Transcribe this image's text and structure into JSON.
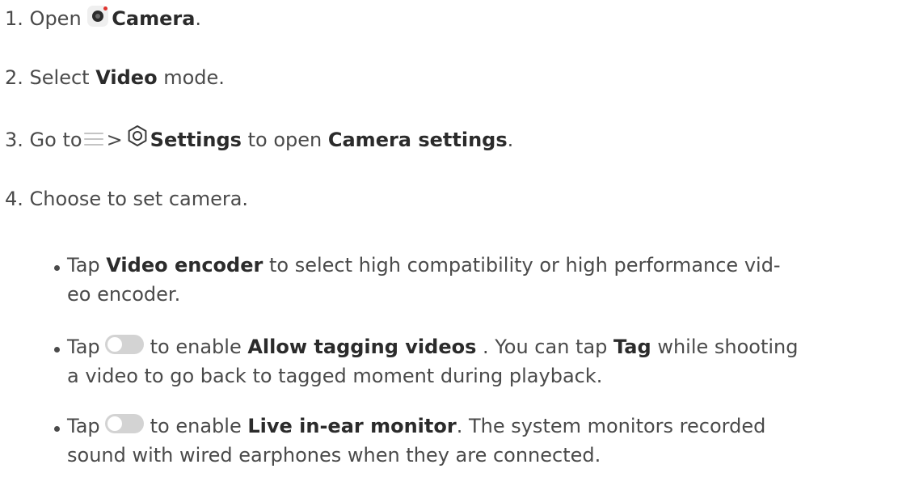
{
  "step1": {
    "num": "1.",
    "pre": "Open",
    "bold": "Camera",
    "post": "."
  },
  "step2": {
    "num": "2.",
    "pre": "Select",
    "bold": "Video",
    "post": "mode."
  },
  "step3": {
    "num": "3.",
    "pre": "Go to",
    "sep": ">",
    "bold1": "Settings",
    "mid": "to open",
    "bold2": "Camera settings",
    "post": "."
  },
  "step4": {
    "num": "4.",
    "text": "Choose to set camera."
  },
  "bullets": [
    {
      "pre": "Tap",
      "bold": "Video encoder",
      "post1": "to select high compatibility or high performance vid-",
      "line2": "eo encoder."
    },
    {
      "pre": "Tap",
      "mid": "to enable",
      "bold": "Allow tagging videos",
      "post": ". You can tap",
      "bold2": "Tag",
      "post2": "while shooting",
      "line2": "a video to go back to tagged moment during playback."
    },
    {
      "pre": "Tap",
      "mid": "to enable",
      "bold": "Live in-ear monitor",
      "post": ". The system monitors recorded",
      "line2": "sound with wired earphones when they are connected."
    }
  ],
  "icons": {
    "camera": "camera-app-icon",
    "menu": "hamburger-menu-icon",
    "settings": "settings-gear-icon",
    "toggle": "toggle-switch-off-icon"
  },
  "colors": {
    "text": "#4a4a4a",
    "bold": "#2b2b2b",
    "toggle": "#d3d3d3",
    "camera_dot": "#e0342f"
  }
}
